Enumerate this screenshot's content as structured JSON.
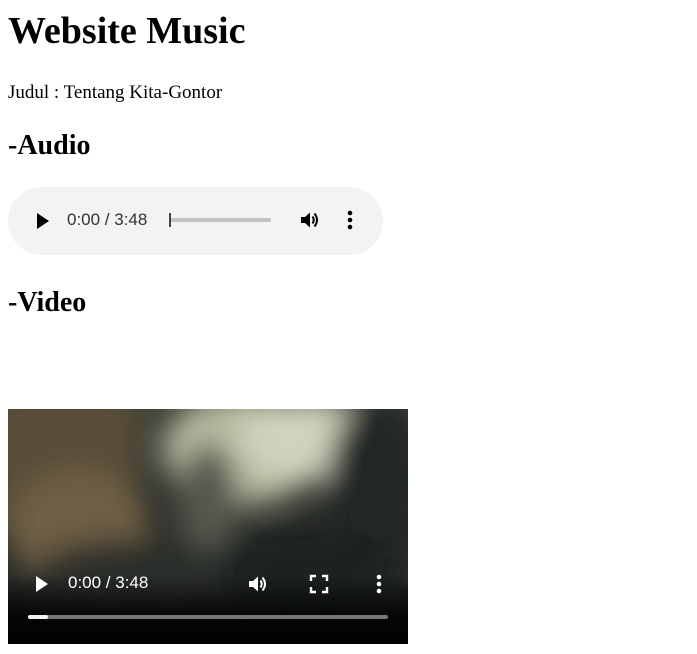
{
  "page": {
    "title": "Website Music",
    "song_line": "Judul : Tentang Kita-Gontor"
  },
  "sections": {
    "audio_heading": "-Audio",
    "video_heading": "-Video"
  },
  "audio_player": {
    "time_display": "0:00 / 3:48",
    "progress_fraction": 0,
    "icons": [
      "play-icon",
      "volume-icon",
      "more-options-icon"
    ]
  },
  "video_player": {
    "time_display": "0:00 / 3:48",
    "progress_fraction": 0,
    "icons": [
      "play-icon",
      "volume-icon",
      "fullscreen-icon",
      "more-options-icon"
    ]
  }
}
